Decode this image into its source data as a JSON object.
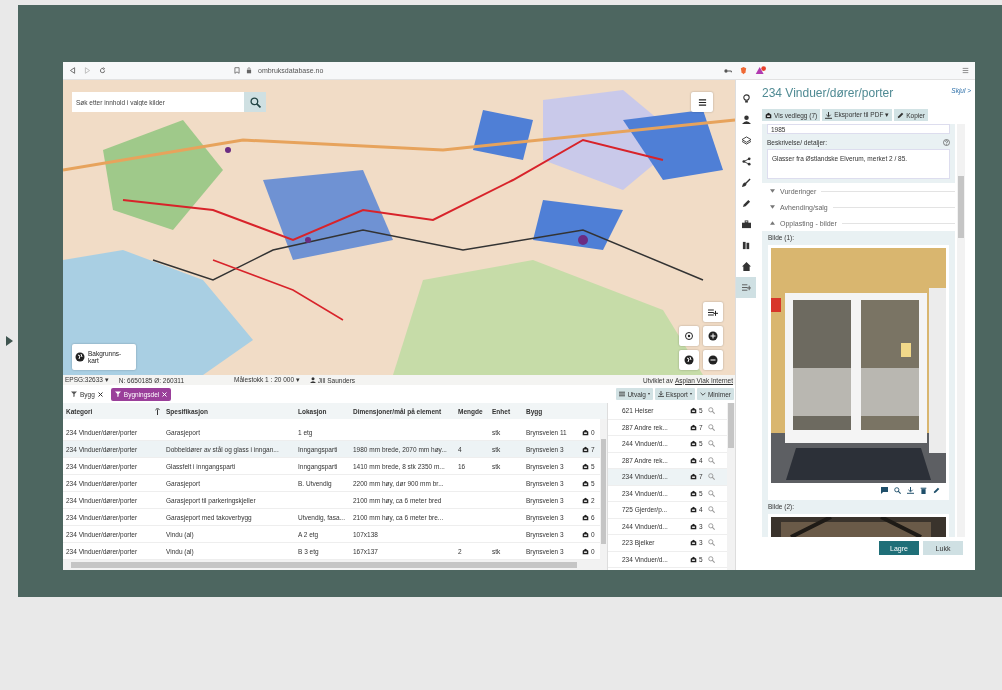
{
  "browser": {
    "url": "ombruksdatabase.no"
  },
  "map": {
    "search_placeholder": "Søk etter innhold i valgte kilder",
    "background_button": "Bakgrunns-kart",
    "status": {
      "projection": "EPSG:32633 ▾",
      "coords": "N: 6650185 Ø: 260311",
      "scale": "Målestokk 1 : 20 000 ▾",
      "user": "Jill Saunders",
      "credit": "Utviklet av",
      "credit_link": "Asplan Viak Internet"
    }
  },
  "filters": [
    {
      "label": "Bygg",
      "selected": false
    },
    {
      "label": "Bygningsdel",
      "selected": true
    }
  ],
  "table_actions": [
    {
      "label": "Utvalg",
      "kind": "filter"
    },
    {
      "label": "Eksport",
      "kind": "export"
    },
    {
      "label": "Minimer",
      "kind": "collapse"
    }
  ],
  "table": {
    "columns": [
      {
        "label": "Kategori",
        "sorted": true
      },
      {
        "label": "Spesifikasjon",
        "sorted": false
      },
      {
        "label": "Lokasjon",
        "sorted": false
      },
      {
        "label": "Dimensjoner/mål på element",
        "sorted": false
      },
      {
        "label": "Mengde",
        "sorted": false
      },
      {
        "label": "Enhet",
        "sorted": false
      },
      {
        "label": "Bygg",
        "sorted": false
      }
    ],
    "rows": [
      {
        "cells": [
          "234 Vinduer/dører/porter",
          "Garasjeport",
          "1 etg",
          null,
          null,
          "stk",
          "Brynsveien 11"
        ],
        "attachments": "0",
        "selected": false
      },
      {
        "cells": [
          "234 Vinduer/dører/porter",
          "Dobbeldører av stål og glass i inngan...",
          "Inngangsparti",
          "1980 mm brede, 2070 mm høy...",
          "4",
          "stk",
          "Brynsveien 3"
        ],
        "attachments": "7",
        "selected": true
      },
      {
        "cells": [
          "234 Vinduer/dører/porter",
          "Glassfelt i inngangsparti",
          "Inngangsparti",
          "1410 mm brede, 8 stk 2350 m...",
          "16",
          "stk",
          "Brynsveien 3"
        ],
        "attachments": "5",
        "selected": false
      },
      {
        "cells": [
          "234 Vinduer/dører/porter",
          "Garasjeport",
          "B. Utvendig",
          "2200 mm høy, dør 900 mm br...",
          null,
          null,
          "Brynsveien 3"
        ],
        "attachments": "5",
        "selected": false
      },
      {
        "cells": [
          "234 Vinduer/dører/porter",
          "Garasjeport til parkeringskjeller",
          null,
          "2100 mm høy, ca 6 meter bred",
          null,
          null,
          "Brynsveien 3"
        ],
        "attachments": "2",
        "selected": false
      },
      {
        "cells": [
          "234 Vinduer/dører/porter",
          "Garasjeport med takoverbygg",
          "Utvendig, fasa...",
          "2100 mm høy, ca 6 meter bre...",
          null,
          null,
          "Brynsveien 3"
        ],
        "attachments": "6",
        "selected": false
      },
      {
        "cells": [
          "234 Vinduer/dører/porter",
          "Vindu (al)",
          "A 2 etg",
          "107x138",
          null,
          null,
          "Brynsveien 3"
        ],
        "attachments": "0",
        "selected": false
      },
      {
        "cells": [
          "234 Vinduer/dører/porter",
          "Vindu (al)",
          "B 3 etg",
          "167x137",
          "2",
          "stk",
          "Brynsveien 3"
        ],
        "attachments": "0",
        "selected": false
      }
    ]
  },
  "list": {
    "rows": [
      {
        "label": "621 Heiser",
        "count": "5",
        "selected": false
      },
      {
        "label": "287 Andre rek...",
        "count": "7",
        "selected": false
      },
      {
        "label": "244 Vinduer/d...",
        "count": "5",
        "selected": false
      },
      {
        "label": "287 Andre rek...",
        "count": "4",
        "selected": false
      },
      {
        "label": "234 Vinduer/d...",
        "count": "7",
        "selected": true
      },
      {
        "label": "234 Vinduer/d...",
        "count": "5",
        "selected": false
      },
      {
        "label": "725 Gjerder/p...",
        "count": "4",
        "selected": false
      },
      {
        "label": "244 Vinduer/d...",
        "count": "3",
        "selected": false
      },
      {
        "label": "223 Bjelker",
        "count": "3",
        "selected": false
      },
      {
        "label": "234 Vinduer/d...",
        "count": "5",
        "selected": false
      }
    ]
  },
  "nav": [
    {
      "kind": "bulb",
      "selected": false
    },
    {
      "kind": "person",
      "selected": false
    },
    {
      "kind": "layers",
      "selected": false
    },
    {
      "kind": "share",
      "selected": false
    },
    {
      "kind": "brush",
      "selected": false
    },
    {
      "kind": "pencil",
      "selected": false
    },
    {
      "kind": "briefcase",
      "selected": false
    },
    {
      "kind": "book",
      "selected": false
    },
    {
      "kind": "home",
      "selected": false
    },
    {
      "kind": "addlist",
      "selected": true
    }
  ],
  "detail": {
    "title": "234 Vinduer/dører/porter",
    "hide_link": "Skjul >",
    "actions": [
      {
        "label": "Vis vedlegg (7)",
        "kind": "attach"
      },
      {
        "label": "Eksporter til PDF ▾",
        "kind": "export"
      },
      {
        "label": "Kopier",
        "kind": "copy"
      }
    ],
    "year_value": "1985",
    "description_label": "Beskrivelse/ detaljer:",
    "description_value": "Glasser fra Østlandske Elverum, merket 2 / 85.",
    "sections": [
      {
        "label": "Vurderinger",
        "expanded": false
      },
      {
        "label": "Avhending/salg",
        "expanded": false
      },
      {
        "label": "Opplasting - bilder",
        "expanded": true
      }
    ],
    "images": [
      {
        "label": "Bilde (1):",
        "kind": "picture"
      },
      {
        "label": "Bilde (2):",
        "kind": "picture"
      }
    ],
    "footer_buttons": [
      {
        "label": "Lagre",
        "kind": "primary"
      },
      {
        "label": "Lukk",
        "kind": "secondary"
      }
    ]
  }
}
